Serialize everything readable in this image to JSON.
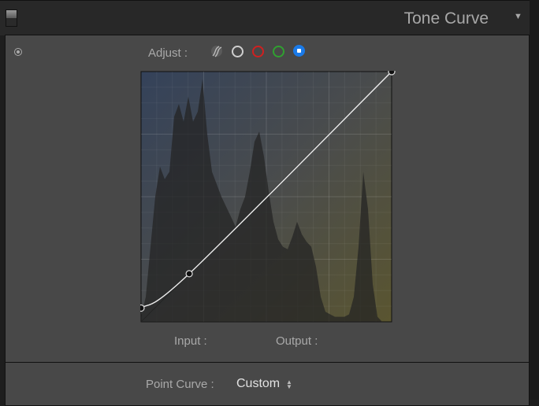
{
  "header": {
    "title": "Tone Curve",
    "collapse_icon": "triangle-down"
  },
  "adjust": {
    "label": "Adjust :",
    "channels": [
      {
        "name": "parametric",
        "color": "#9a9a9a",
        "selected": false
      },
      {
        "name": "rgb",
        "color": "#cfcfcf",
        "selected": false
      },
      {
        "name": "red",
        "color": "#d02020",
        "selected": false
      },
      {
        "name": "green",
        "color": "#30a030",
        "selected": false
      },
      {
        "name": "blue",
        "color": "#1a7ae8",
        "selected": true
      }
    ]
  },
  "curve": {
    "range": [
      0,
      255
    ],
    "points": [
      [
        0,
        14
      ],
      [
        49,
        49
      ],
      [
        255,
        255
      ]
    ],
    "histogram": [
      0.02,
      0.1,
      0.3,
      0.5,
      0.62,
      0.57,
      0.6,
      0.82,
      0.87,
      0.8,
      0.9,
      0.8,
      0.84,
      0.97,
      0.75,
      0.6,
      0.55,
      0.5,
      0.46,
      0.42,
      0.38,
      0.45,
      0.5,
      0.6,
      0.72,
      0.76,
      0.66,
      0.52,
      0.4,
      0.33,
      0.3,
      0.29,
      0.34,
      0.4,
      0.35,
      0.32,
      0.3,
      0.22,
      0.1,
      0.04,
      0.03,
      0.02,
      0.02,
      0.02,
      0.03,
      0.1,
      0.3,
      0.6,
      0.45,
      0.15,
      0.02,
      0.0,
      0.0,
      0.0
    ]
  },
  "readout": {
    "input_label": "Input :",
    "output_label": "Output :"
  },
  "point_curve": {
    "label": "Point Curve :",
    "value": "Custom"
  }
}
